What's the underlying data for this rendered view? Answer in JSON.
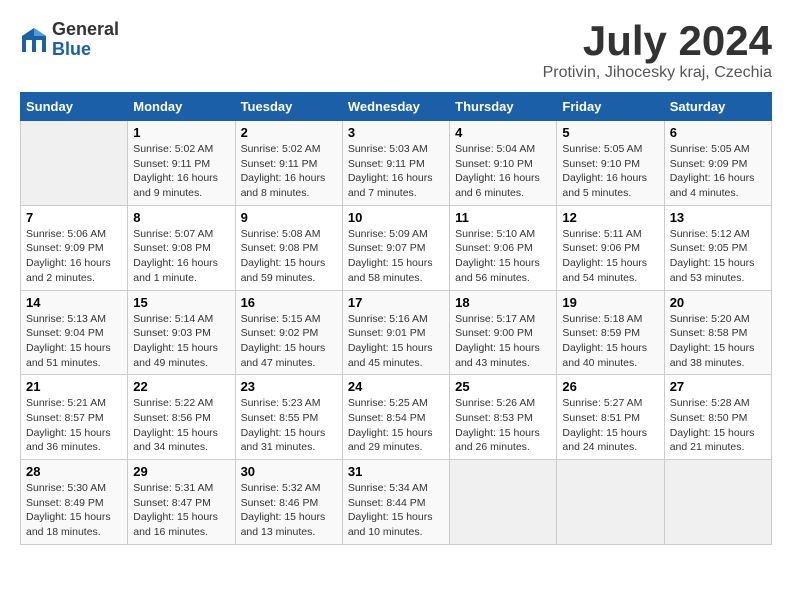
{
  "header": {
    "logo_general": "General",
    "logo_blue": "Blue",
    "title": "July 2024",
    "location": "Protivin, Jihocesky kraj, Czechia"
  },
  "days_of_week": [
    "Sunday",
    "Monday",
    "Tuesday",
    "Wednesday",
    "Thursday",
    "Friday",
    "Saturday"
  ],
  "weeks": [
    [
      {
        "day": "",
        "empty": true
      },
      {
        "day": "1",
        "sunrise": "Sunrise: 5:02 AM",
        "sunset": "Sunset: 9:11 PM",
        "daylight": "Daylight: 16 hours and 9 minutes."
      },
      {
        "day": "2",
        "sunrise": "Sunrise: 5:02 AM",
        "sunset": "Sunset: 9:11 PM",
        "daylight": "Daylight: 16 hours and 8 minutes."
      },
      {
        "day": "3",
        "sunrise": "Sunrise: 5:03 AM",
        "sunset": "Sunset: 9:11 PM",
        "daylight": "Daylight: 16 hours and 7 minutes."
      },
      {
        "day": "4",
        "sunrise": "Sunrise: 5:04 AM",
        "sunset": "Sunset: 9:10 PM",
        "daylight": "Daylight: 16 hours and 6 minutes."
      },
      {
        "day": "5",
        "sunrise": "Sunrise: 5:05 AM",
        "sunset": "Sunset: 9:10 PM",
        "daylight": "Daylight: 16 hours and 5 minutes."
      },
      {
        "day": "6",
        "sunrise": "Sunrise: 5:05 AM",
        "sunset": "Sunset: 9:09 PM",
        "daylight": "Daylight: 16 hours and 4 minutes."
      }
    ],
    [
      {
        "day": "7",
        "sunrise": "Sunrise: 5:06 AM",
        "sunset": "Sunset: 9:09 PM",
        "daylight": "Daylight: 16 hours and 2 minutes."
      },
      {
        "day": "8",
        "sunrise": "Sunrise: 5:07 AM",
        "sunset": "Sunset: 9:08 PM",
        "daylight": "Daylight: 16 hours and 1 minute."
      },
      {
        "day": "9",
        "sunrise": "Sunrise: 5:08 AM",
        "sunset": "Sunset: 9:08 PM",
        "daylight": "Daylight: 15 hours and 59 minutes."
      },
      {
        "day": "10",
        "sunrise": "Sunrise: 5:09 AM",
        "sunset": "Sunset: 9:07 PM",
        "daylight": "Daylight: 15 hours and 58 minutes."
      },
      {
        "day": "11",
        "sunrise": "Sunrise: 5:10 AM",
        "sunset": "Sunset: 9:06 PM",
        "daylight": "Daylight: 15 hours and 56 minutes."
      },
      {
        "day": "12",
        "sunrise": "Sunrise: 5:11 AM",
        "sunset": "Sunset: 9:06 PM",
        "daylight": "Daylight: 15 hours and 54 minutes."
      },
      {
        "day": "13",
        "sunrise": "Sunrise: 5:12 AM",
        "sunset": "Sunset: 9:05 PM",
        "daylight": "Daylight: 15 hours and 53 minutes."
      }
    ],
    [
      {
        "day": "14",
        "sunrise": "Sunrise: 5:13 AM",
        "sunset": "Sunset: 9:04 PM",
        "daylight": "Daylight: 15 hours and 51 minutes."
      },
      {
        "day": "15",
        "sunrise": "Sunrise: 5:14 AM",
        "sunset": "Sunset: 9:03 PM",
        "daylight": "Daylight: 15 hours and 49 minutes."
      },
      {
        "day": "16",
        "sunrise": "Sunrise: 5:15 AM",
        "sunset": "Sunset: 9:02 PM",
        "daylight": "Daylight: 15 hours and 47 minutes."
      },
      {
        "day": "17",
        "sunrise": "Sunrise: 5:16 AM",
        "sunset": "Sunset: 9:01 PM",
        "daylight": "Daylight: 15 hours and 45 minutes."
      },
      {
        "day": "18",
        "sunrise": "Sunrise: 5:17 AM",
        "sunset": "Sunset: 9:00 PM",
        "daylight": "Daylight: 15 hours and 43 minutes."
      },
      {
        "day": "19",
        "sunrise": "Sunrise: 5:18 AM",
        "sunset": "Sunset: 8:59 PM",
        "daylight": "Daylight: 15 hours and 40 minutes."
      },
      {
        "day": "20",
        "sunrise": "Sunrise: 5:20 AM",
        "sunset": "Sunset: 8:58 PM",
        "daylight": "Daylight: 15 hours and 38 minutes."
      }
    ],
    [
      {
        "day": "21",
        "sunrise": "Sunrise: 5:21 AM",
        "sunset": "Sunset: 8:57 PM",
        "daylight": "Daylight: 15 hours and 36 minutes."
      },
      {
        "day": "22",
        "sunrise": "Sunrise: 5:22 AM",
        "sunset": "Sunset: 8:56 PM",
        "daylight": "Daylight: 15 hours and 34 minutes."
      },
      {
        "day": "23",
        "sunrise": "Sunrise: 5:23 AM",
        "sunset": "Sunset: 8:55 PM",
        "daylight": "Daylight: 15 hours and 31 minutes."
      },
      {
        "day": "24",
        "sunrise": "Sunrise: 5:25 AM",
        "sunset": "Sunset: 8:54 PM",
        "daylight": "Daylight: 15 hours and 29 minutes."
      },
      {
        "day": "25",
        "sunrise": "Sunrise: 5:26 AM",
        "sunset": "Sunset: 8:53 PM",
        "daylight": "Daylight: 15 hours and 26 minutes."
      },
      {
        "day": "26",
        "sunrise": "Sunrise: 5:27 AM",
        "sunset": "Sunset: 8:51 PM",
        "daylight": "Daylight: 15 hours and 24 minutes."
      },
      {
        "day": "27",
        "sunrise": "Sunrise: 5:28 AM",
        "sunset": "Sunset: 8:50 PM",
        "daylight": "Daylight: 15 hours and 21 minutes."
      }
    ],
    [
      {
        "day": "28",
        "sunrise": "Sunrise: 5:30 AM",
        "sunset": "Sunset: 8:49 PM",
        "daylight": "Daylight: 15 hours and 18 minutes."
      },
      {
        "day": "29",
        "sunrise": "Sunrise: 5:31 AM",
        "sunset": "Sunset: 8:47 PM",
        "daylight": "Daylight: 15 hours and 16 minutes."
      },
      {
        "day": "30",
        "sunrise": "Sunrise: 5:32 AM",
        "sunset": "Sunset: 8:46 PM",
        "daylight": "Daylight: 15 hours and 13 minutes."
      },
      {
        "day": "31",
        "sunrise": "Sunrise: 5:34 AM",
        "sunset": "Sunset: 8:44 PM",
        "daylight": "Daylight: 15 hours and 10 minutes."
      },
      {
        "day": "",
        "empty": true
      },
      {
        "day": "",
        "empty": true
      },
      {
        "day": "",
        "empty": true
      }
    ]
  ]
}
